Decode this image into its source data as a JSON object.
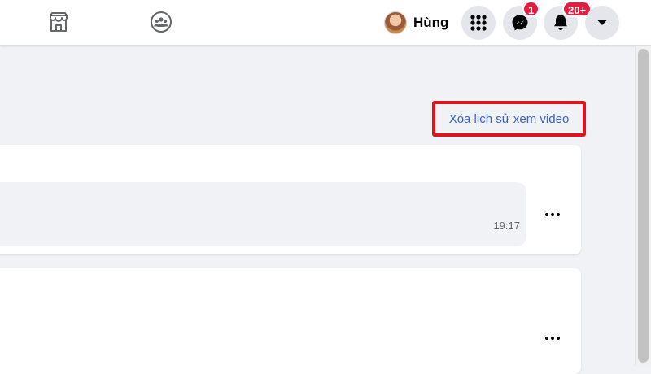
{
  "header": {
    "marketplace_icon": "storefront-icon",
    "groups_icon": "groups-icon",
    "profile": {
      "name": "Hùng"
    },
    "menu_icon": "grid-menu-icon",
    "messenger": {
      "icon": "messenger-icon",
      "badge": "1"
    },
    "notifications": {
      "icon": "bell-icon",
      "badge": "20+"
    },
    "account_icon": "caret-down-icon"
  },
  "main": {
    "clear_history_label": "Xóa lịch sử xem video",
    "items": [
      {
        "timestamp": "19:17"
      },
      {
        "timestamp": ""
      }
    ]
  },
  "colors": {
    "accent": "#3a63c8",
    "highlight_border": "#e0141e",
    "badge": "#e41e3f"
  }
}
